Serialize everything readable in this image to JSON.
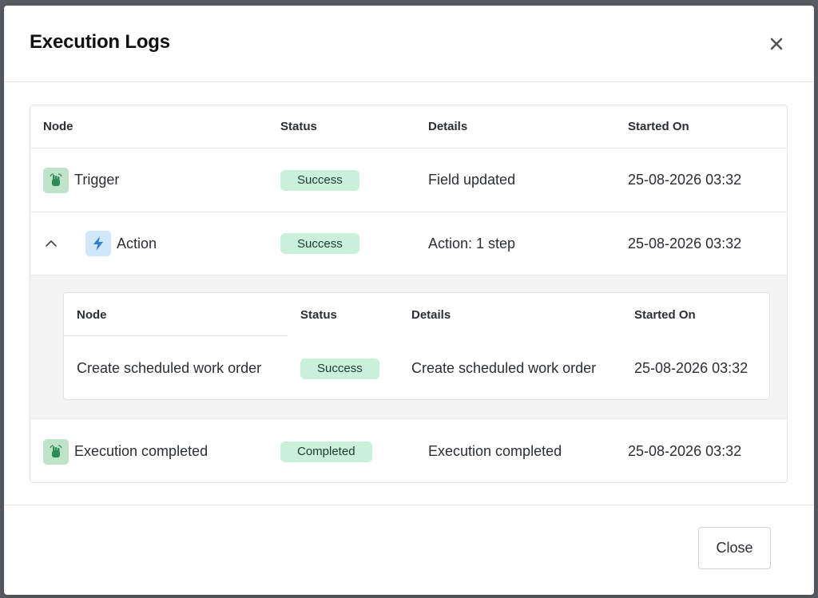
{
  "modal": {
    "title": "Execution Logs",
    "close_label": "Close"
  },
  "table": {
    "headers": {
      "node": "Node",
      "status": "Status",
      "details": "Details",
      "started_on": "Started On"
    },
    "rows": [
      {
        "node": "Trigger",
        "icon": "hand-tap-icon",
        "status": "Success",
        "details": "Field updated",
        "started_on": "25-08-2026 03:32"
      },
      {
        "node": "Action",
        "icon": "lightning-icon",
        "status": "Success",
        "details": "Action: 1 step",
        "started_on": "25-08-2026 03:32",
        "expanded": true
      },
      {
        "node": "Execution completed",
        "icon": "hand-tap-icon",
        "status": "Completed",
        "details": "Execution completed",
        "started_on": "25-08-2026 03:32"
      }
    ]
  },
  "sub_table": {
    "headers": {
      "node": "Node",
      "status": "Status",
      "details": "Details",
      "started_on": "Started On"
    },
    "rows": [
      {
        "node": "Create scheduled work order",
        "status": "Success",
        "details": "Create scheduled work order",
        "started_on": "25-08-2026 03:32"
      }
    ]
  },
  "colors": {
    "badge_bg": "#c9f0d9",
    "trigger_icon_bg": "#bfe3c9",
    "action_icon_bg": "#cfe7f8",
    "action_icon": "#2f7fd1",
    "trigger_icon": "#2e8b57"
  }
}
